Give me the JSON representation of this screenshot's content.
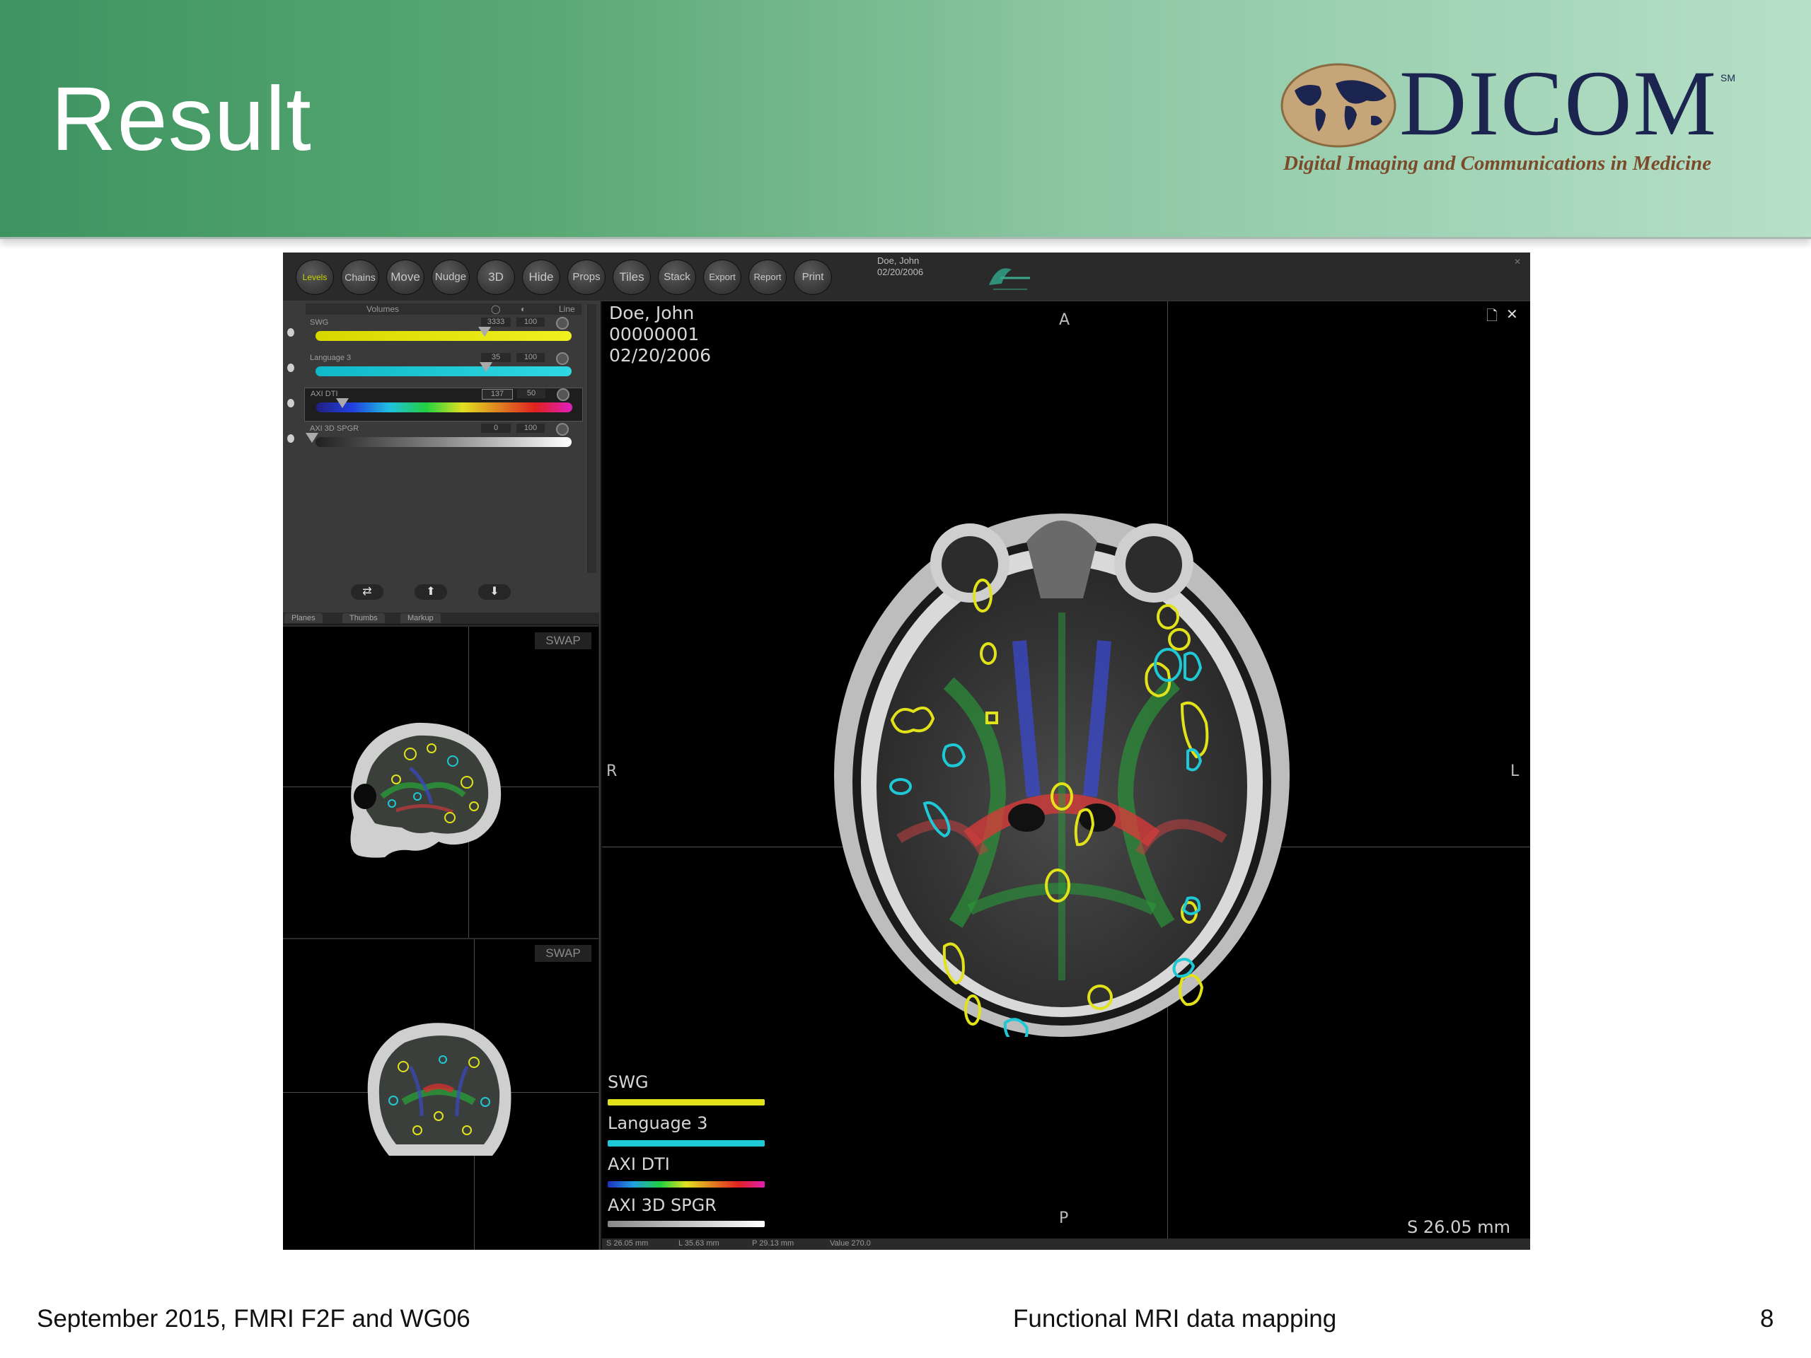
{
  "slide": {
    "title": "Result",
    "footer_left": "September 2015, FMRI F2F and WG06",
    "footer_center": "Functional MRI data mapping",
    "page_number": "8"
  },
  "logo": {
    "wordmark": "DICOM",
    "sm": "SM",
    "tagline": "Digital Imaging and Communications in Medicine"
  },
  "toolbar": {
    "buttons": [
      "Levels",
      "Chains",
      "Move",
      "Nudge",
      "3D",
      "Hide",
      "Props",
      "Tiles",
      "Stack",
      "Export",
      "Report",
      "Print"
    ],
    "patient_name": "Doe, John",
    "patient_date": "02/20/2006"
  },
  "volumes_panel": {
    "header": "Volumes",
    "header_line": "Line",
    "rows": [
      {
        "name": "SWG",
        "value1": "3333",
        "value2": "100",
        "color": "#e8e800"
      },
      {
        "name": "Language 3",
        "value1": "35",
        "value2": "100",
        "color": "#20c8d8"
      },
      {
        "name": "AXI DTI",
        "value1": "137",
        "value2": "50"
      },
      {
        "name": "AXI 3D SPGR",
        "value1": "0",
        "value2": "100"
      }
    ],
    "tabs": [
      "Planes",
      "Thumbs",
      "Markup"
    ]
  },
  "thumbnails": {
    "swap_label": "SWAP"
  },
  "main_view": {
    "patient_name": "Doe, John",
    "patient_id": "00000001",
    "patient_date": "02/20/2006",
    "orientation": {
      "top": "A",
      "bottom": "P",
      "left": "R",
      "right": "L"
    },
    "legend": [
      {
        "label": "SWG",
        "color": "#e2e21a"
      },
      {
        "label": "Language 3",
        "color": "#1ec8d4"
      },
      {
        "label": "AXI DTI",
        "color": "rainbow"
      },
      {
        "label": "AXI 3D SPGR",
        "color": "#e6e6e6"
      }
    ],
    "slice_position": "S 26.05 mm",
    "status": [
      "S 26.05 mm",
      "L 35.63 mm",
      "P 29.13 mm",
      "Value 270.0"
    ]
  }
}
